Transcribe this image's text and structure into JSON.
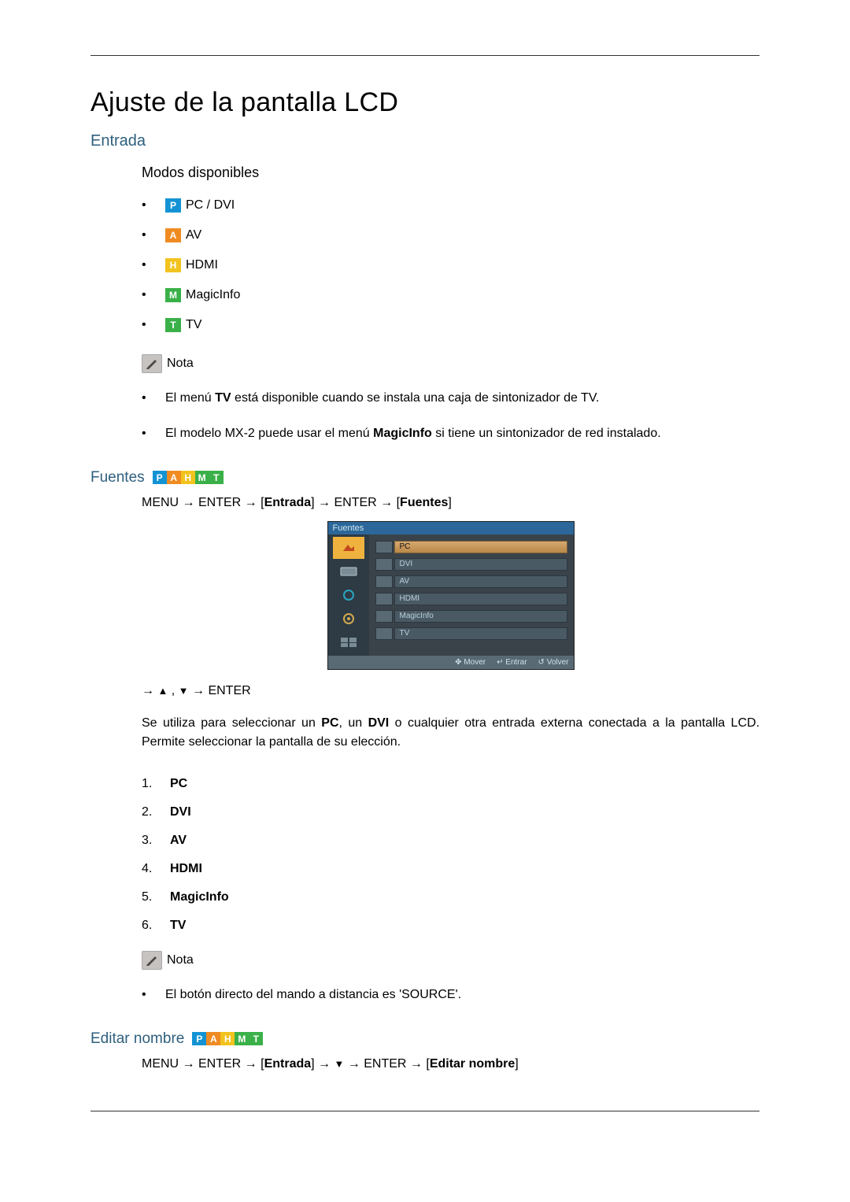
{
  "page_title": "Ajuste de la pantalla LCD",
  "entrada": {
    "heading": "Entrada",
    "modos_heading": "Modos disponibles",
    "modes": [
      {
        "badge": "P",
        "label": "PC / DVI"
      },
      {
        "badge": "A",
        "label": "AV"
      },
      {
        "badge": "H",
        "label": "HDMI"
      },
      {
        "badge": "M",
        "label": "MagicInfo"
      },
      {
        "badge": "T",
        "label": "TV"
      }
    ],
    "nota_label": "Nota",
    "nota_items_html": [
      "El menú <span class=\"bold\">TV</span> está disponible cuando se instala una caja de sintonizador de TV.",
      "El modelo MX-2 puede usar el menú <span class=\"bold\">MagicInfo</span> si tiene un sintonizador de red instalado."
    ]
  },
  "fuentes": {
    "heading": "Fuentes",
    "badges": [
      "P",
      "A",
      "H",
      "M",
      "T"
    ],
    "menu_path_html": "MENU → ENTER → [<span class=\"bkt\">Entrada</span>] → ENTER → [<span class=\"bkt\">Fuentes</span>]",
    "osd": {
      "title": "Fuentes",
      "rows": [
        "PC",
        "DVI",
        "AV",
        "HDMI",
        "MagicInfo",
        "TV"
      ],
      "footer": {
        "mover": "Mover",
        "entrar": "Entrar",
        "volver": "Volver"
      }
    },
    "nav_line_html": "→ <span class=\"nav-tri\">▲</span> , <span class=\"nav-tri\">▼</span> → ENTER",
    "body_html": "Se utiliza para seleccionar un <span class=\"bold\">PC</span>, un <span class=\"bold\">DVI</span> o cualquier otra entrada externa conectada a la pantalla LCD. Permite seleccionar la pantalla de su elección.",
    "list": [
      "PC",
      "DVI",
      "AV",
      "HDMI",
      "MagicInfo",
      "TV"
    ],
    "nota2_label": "Nota",
    "nota2_items": [
      "El botón directo del mando a distancia es 'SOURCE'."
    ]
  },
  "editar": {
    "heading": "Editar nombre",
    "badges": [
      "P",
      "A",
      "H",
      "M",
      "T"
    ],
    "menu_path_html": "MENU → ENTER → [<span class=\"bkt\">Entrada</span>] → <span class=\"nav-tri\">▼</span> → ENTER → [<span class=\"bkt\">Editar nombre</span>]"
  }
}
